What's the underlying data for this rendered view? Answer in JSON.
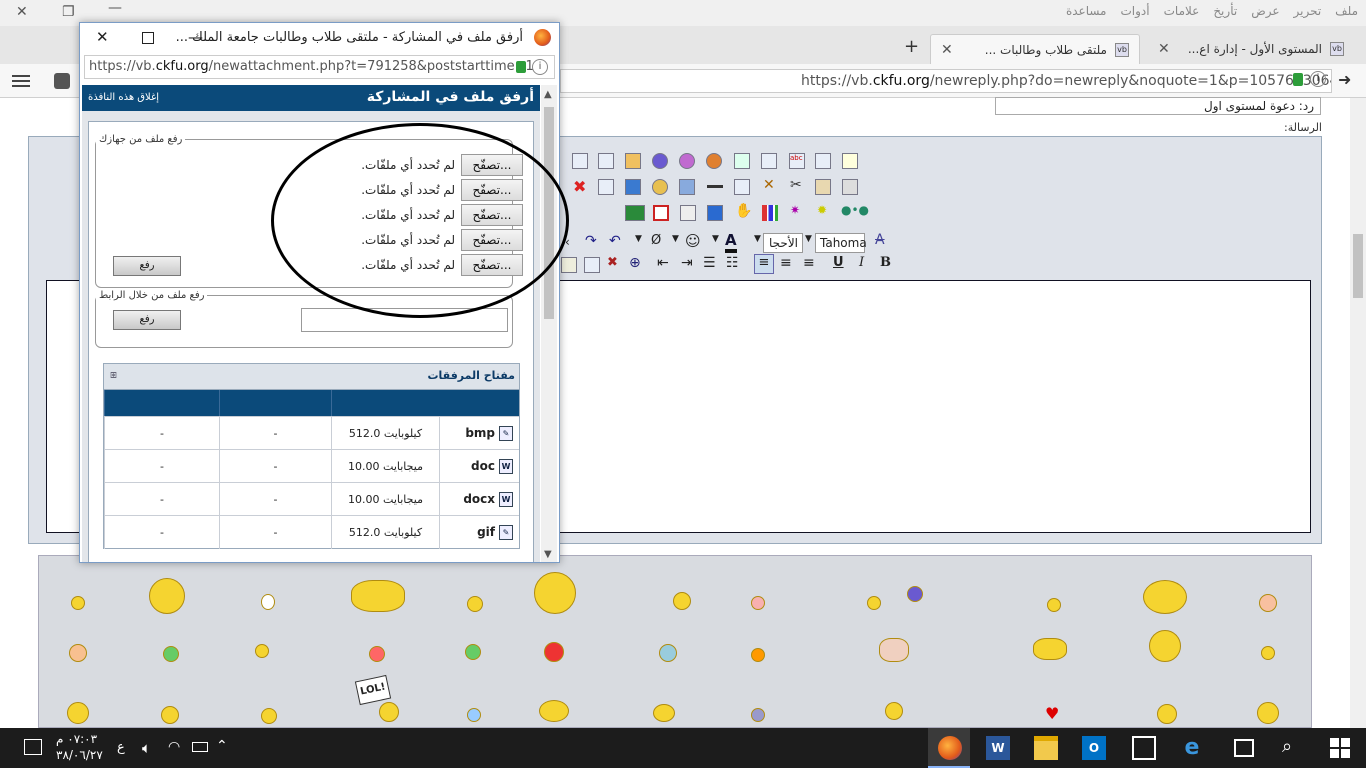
{
  "menu": [
    "ملف",
    "تحرير",
    "عرض",
    "تأريخ",
    "علامات",
    "أدوات",
    "مساعدة"
  ],
  "tabs": [
    {
      "label": "المستوى الأول - إدارة اع..."
    },
    {
      "label": "ملتقى طلاب وطالبات ..."
    }
  ],
  "main_url": {
    "prefix": "https://vb.",
    "domain": "ckfu.org",
    "path": "/newreply.php?do=newreply&noquote=1&p=1057633064"
  },
  "form": {
    "subject_value": "رد: دعوة لمستوى اول",
    "message_label": "الرسالة:"
  },
  "editor": {
    "font_name": "Tahoma",
    "font_size": "الأحجا"
  },
  "popup": {
    "title": "أرفق ملف في المشاركة - ملتقى طلاب وطالبات جامعة الملك ...",
    "url_prefix": "https://vb.",
    "url_domain": "ckfu.org",
    "url_path": "/newattachment.php?t=791258&poststarttime=1",
    "heading": "أرفق ملف في المشاركة",
    "close_link": "إغلاق هذه النافذة",
    "upload_computer_legend": "رفع ملف من جهازك",
    "browse_label": "تصفّح...",
    "no_file_label": "لم تُحدد أي ملفّات.",
    "upload_button": "رفع",
    "upload_url_legend": "رفع ملف من خلال الرابط",
    "table_title": "مفتاح المرفقات",
    "rows": [
      {
        "ext": "bmp",
        "size": "512.0 كيلوبايت",
        "w": "-",
        "h": "-"
      },
      {
        "ext": "doc",
        "size": "10.00 ميجابايت",
        "w": "-",
        "h": "-"
      },
      {
        "ext": "docx",
        "size": "10.00 ميجابايت",
        "w": "-",
        "h": "-"
      },
      {
        "ext": "gif",
        "size": "512.0 كيلوبايت",
        "w": "-",
        "h": "-"
      }
    ]
  },
  "taskbar": {
    "time": "٠٧:٠٣ م",
    "date": "٣٨/٠٦/٢٧",
    "lang": "ع"
  },
  "colors": {
    "header_blue": "#0b4a7a",
    "annotation": "#000000"
  }
}
